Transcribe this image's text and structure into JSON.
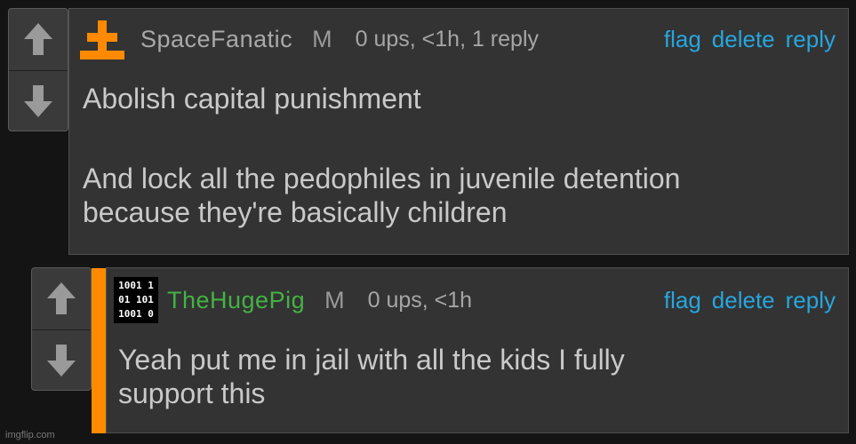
{
  "comments": [
    {
      "username": "SpaceFanatic",
      "mod_badge": "M",
      "meta": "0 ups, <1h, 1 reply",
      "actions": [
        "flag",
        "delete",
        "reply"
      ],
      "lines": [
        "Abolish capital punishment",
        "And lock all the pedophiles in juvenile detention",
        "because they're basically children"
      ],
      "avatar_icon": "orange-cross-icon",
      "username_color": "#a9a9a9"
    },
    {
      "username": "TheHugePig",
      "mod_badge": "M",
      "meta": "0 ups, <1h",
      "actions": [
        "flag",
        "delete",
        "reply"
      ],
      "lines": [
        "Yeah put me in jail with all the kids I fully",
        "support this"
      ],
      "avatar_icon": "binary-code-icon",
      "avatar_text": [
        "1001 1",
        "01 101",
        "1001 0"
      ],
      "username_color": "#44b244"
    }
  ],
  "watermark": "imgflip.com",
  "colors": {
    "accent_link": "#27a6de",
    "reply_bar": "#ff8a00",
    "background": "#141414"
  }
}
